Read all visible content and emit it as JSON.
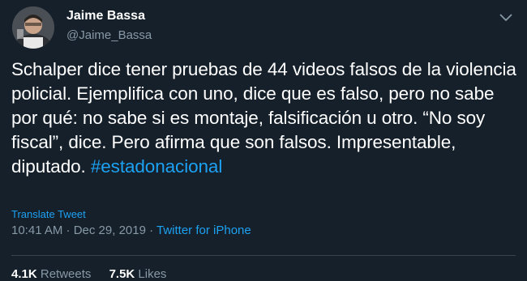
{
  "author": {
    "display_name": "Jaime Bassa",
    "handle": "@Jaime_Bassa"
  },
  "tweet": {
    "text": "Schalper dice tener pruebas de 44 videos falsos de la violencia policial. Ejemplifica con uno, dice que es falso, pero no sabe por qué: no sabe si es montaje, falsificación u otro. “No soy fiscal”, dice. Pero afirma que son falsos. Impresentable, diputado. ",
    "hashtag": "#estadonacional",
    "translate_label": "Translate Tweet",
    "timestamp": "10:41 AM · Dec 29, 2019 · ",
    "source": "Twitter for iPhone"
  },
  "stats": {
    "retweets_count": "4.1K",
    "retweets_label": " Retweets",
    "likes_count": "7.5K",
    "likes_label": " Likes"
  },
  "icons": {
    "more": "chevron-down-icon"
  },
  "colors": {
    "background": "#15202b",
    "text": "#ffffff",
    "secondary_text": "#8899a6",
    "link": "#1da1f2",
    "divider": "#38444d"
  }
}
